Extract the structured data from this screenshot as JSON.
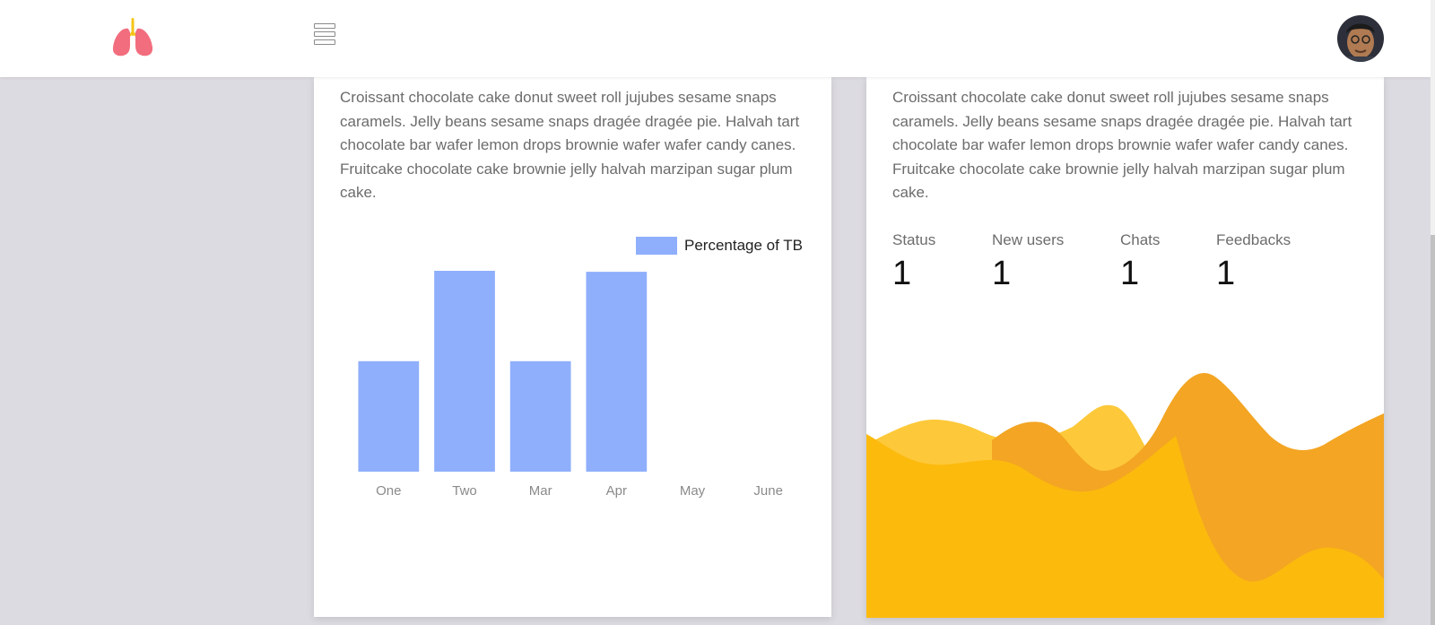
{
  "header": {
    "logo_icon": "lungs-icon",
    "menu_icon": "hamburger-menu-icon",
    "avatar_icon": "user-avatar"
  },
  "left_card": {
    "paragraph": "Croissant chocolate cake donut sweet roll jujubes sesame snaps caramels. Jelly beans sesame snaps dragée dragée pie. Halvah tart chocolate bar wafer lemon drops brownie wafer wafer candy canes. Fruitcake chocolate cake brownie jelly halvah marzipan sugar plum cake."
  },
  "right_card": {
    "paragraph": "Croissant chocolate cake donut sweet roll jujubes sesame snaps caramels. Jelly beans sesame snaps dragée dragée pie. Halvah tart chocolate bar wafer lemon drops brownie wafer wafer candy canes. Fruitcake chocolate cake brownie jelly halvah marzipan sugar plum cake.",
    "stats": [
      {
        "label": "Status",
        "value": "1"
      },
      {
        "label": "New users",
        "value": "1"
      },
      {
        "label": "Chats",
        "value": "1"
      },
      {
        "label": "Feedbacks",
        "value": "1"
      }
    ],
    "wave_colors": [
      "#fcba0d",
      "#f3a523",
      "#fdc93a"
    ]
  },
  "chart_data": {
    "type": "bar",
    "categories": [
      "One",
      "Two",
      "Mar",
      "Apr",
      "May",
      "June"
    ],
    "series": [
      {
        "name": "Percentage of TB",
        "values": [
          55,
          100,
          55,
          99.5,
          0,
          0
        ],
        "color": "#8faffc"
      }
    ],
    "ylim": [
      0,
      100
    ],
    "grid": false,
    "legend": "top-right"
  }
}
